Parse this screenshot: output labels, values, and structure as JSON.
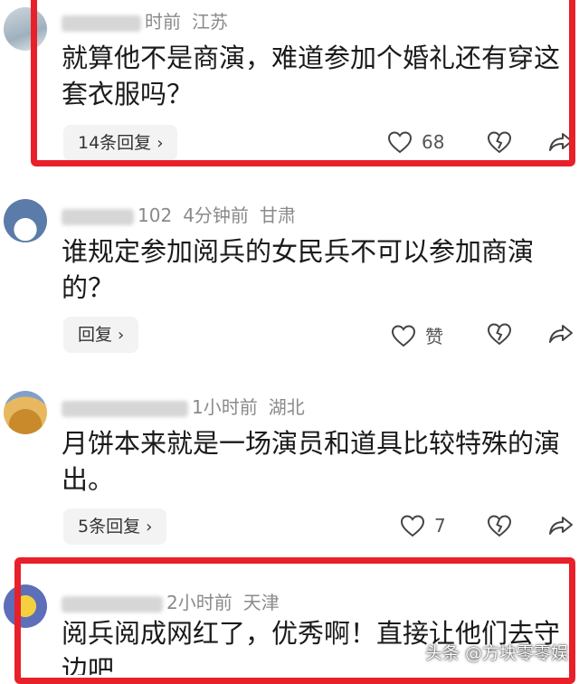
{
  "comments": [
    {
      "meta_time": "时前",
      "meta_place": "江苏",
      "text": "就算他不是商演，难道参加个婚礼还有穿这套衣服吗？",
      "reply_label": "14条回复",
      "like_count": "68"
    },
    {
      "meta_name": "102",
      "meta_time": "4分钟前",
      "meta_place": "甘肃",
      "text": "谁规定参加阅兵的女民兵不可以参加商演的？",
      "reply_label": "回复",
      "like_count": "赞"
    },
    {
      "meta_time": "1小时前",
      "meta_place": "湖北",
      "text": "月饼本来就是一场演员和道具比较特殊的演出。",
      "reply_label": "5条回复",
      "like_count": "7"
    },
    {
      "meta_time": "2小时前",
      "meta_place": "天津",
      "text": "阅兵阅成网红了，优秀啊！直接让他们去守边吧"
    }
  ],
  "icons": {
    "like": "heart-icon",
    "dislike": "broken-heart-icon",
    "share": "share-arrow-icon",
    "reply_chevron": "chevron-right-icon"
  },
  "chevron": "›",
  "colors": {
    "highlight": "#e8202a",
    "meta": "#8a8a8a",
    "pill": "#f3f3f3"
  },
  "watermark": "头条 @方块零零娱"
}
